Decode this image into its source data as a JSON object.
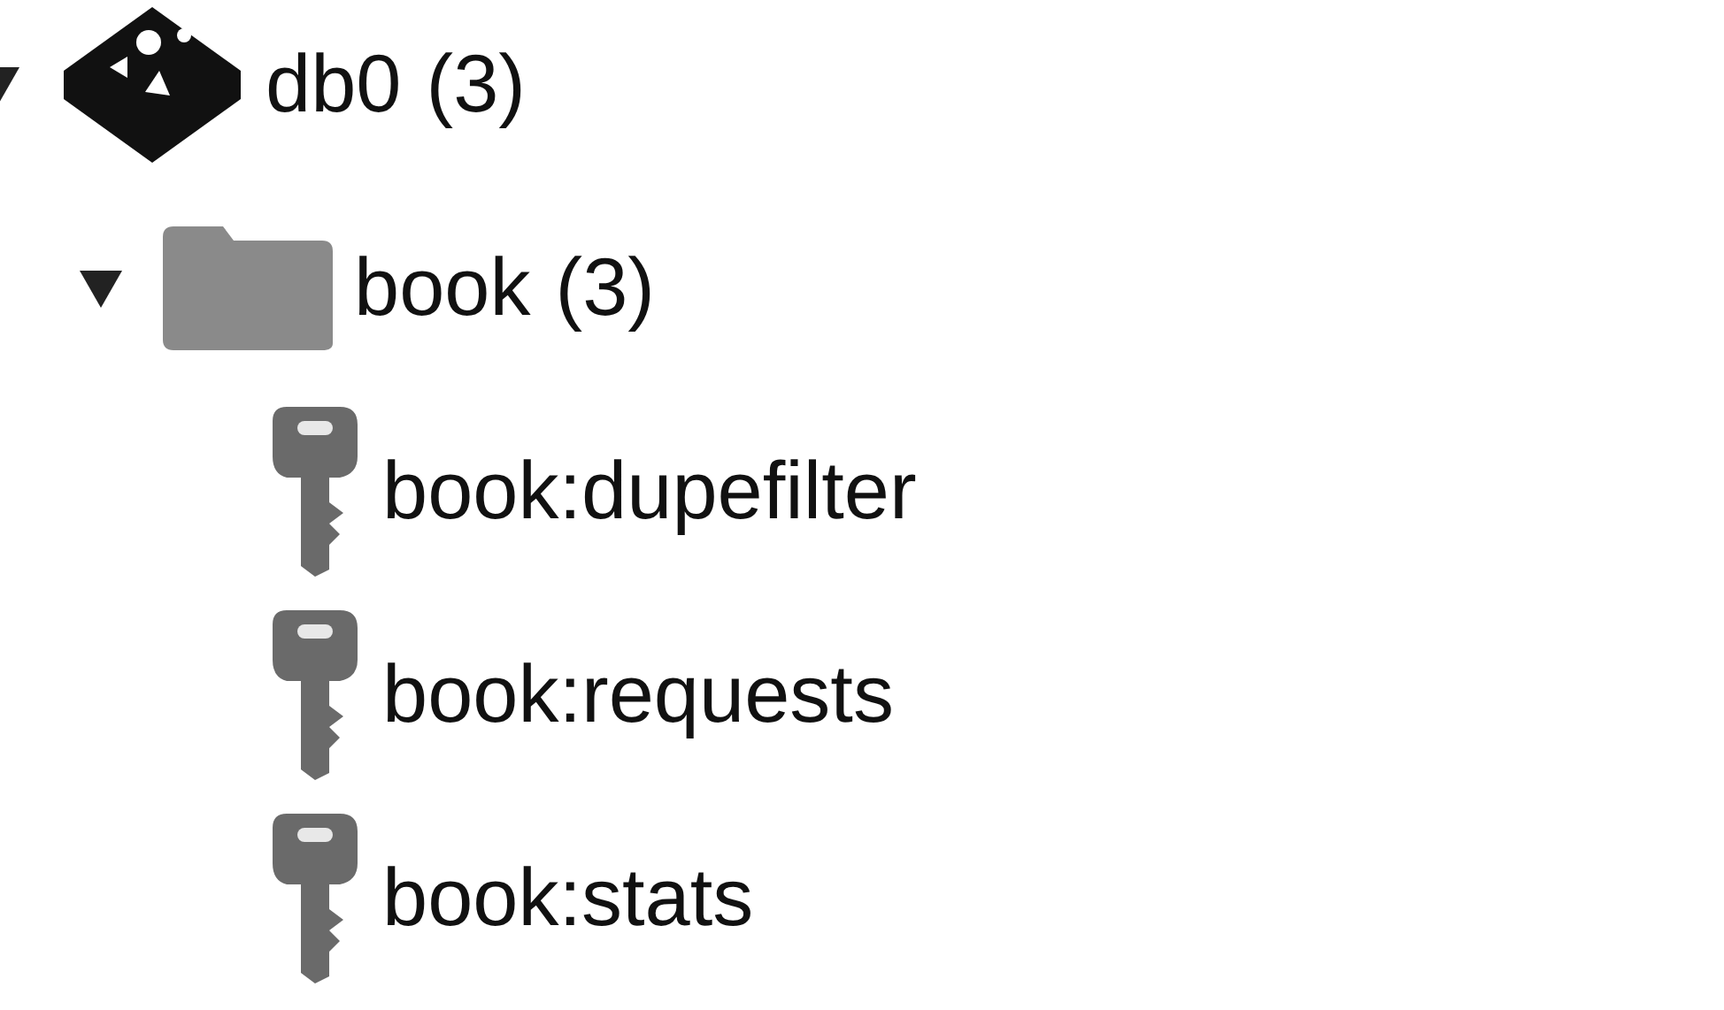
{
  "tree": [
    {
      "kind": "database",
      "label": "db0",
      "count": "(3)",
      "expanded": true,
      "children": [
        {
          "kind": "folder",
          "label": "book",
          "count": "(3)",
          "expanded": true,
          "children": [
            {
              "kind": "key",
              "label": "book:dupefilter"
            },
            {
              "kind": "key",
              "label": "book:requests"
            },
            {
              "kind": "key",
              "label": "book:stats"
            }
          ]
        }
      ]
    }
  ]
}
